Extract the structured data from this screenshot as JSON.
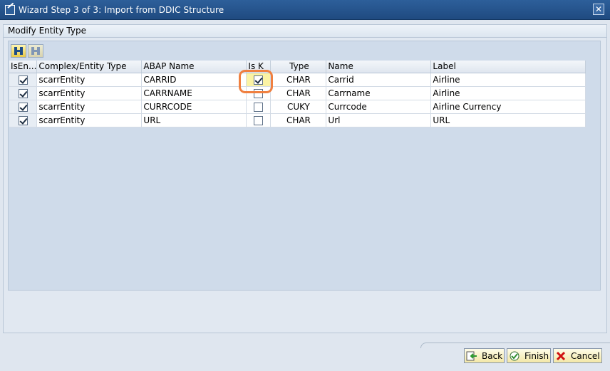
{
  "window": {
    "title": "Wizard Step 3 of 3: Import from DDIC Structure"
  },
  "group": {
    "title": "Modify Entity Type"
  },
  "toolbar": {
    "buttons": [
      {
        "icon": "binoculars-icon"
      },
      {
        "icon": "binoculars-next-icon"
      }
    ]
  },
  "table": {
    "headers": [
      "IsEn...",
      "Complex/Entity Type",
      "ABAP Name",
      "Is K",
      "Type",
      "Name",
      "Label"
    ],
    "rows": [
      {
        "is_entity": true,
        "entity_type": "scarrEntity",
        "abap_name": "CARRID",
        "is_key": true,
        "type": "CHAR",
        "name": "Carrid",
        "label": "Airline"
      },
      {
        "is_entity": true,
        "entity_type": "scarrEntity",
        "abap_name": "CARRNAME",
        "is_key": false,
        "type": "CHAR",
        "name": "Carrname",
        "label": "Airline"
      },
      {
        "is_entity": true,
        "entity_type": "scarrEntity",
        "abap_name": "CURRCODE",
        "is_key": false,
        "type": "CUKY",
        "name": "Currcode",
        "label": "Airline Currency"
      },
      {
        "is_entity": true,
        "entity_type": "scarrEntity",
        "abap_name": "URL",
        "is_key": false,
        "type": "CHAR",
        "name": "Url",
        "label": "URL"
      }
    ]
  },
  "buttons": {
    "back": "Back",
    "finish": "Finish",
    "cancel": "Cancel"
  },
  "colors": {
    "accent": "#f08040",
    "title_bar": "#1f4a80"
  }
}
